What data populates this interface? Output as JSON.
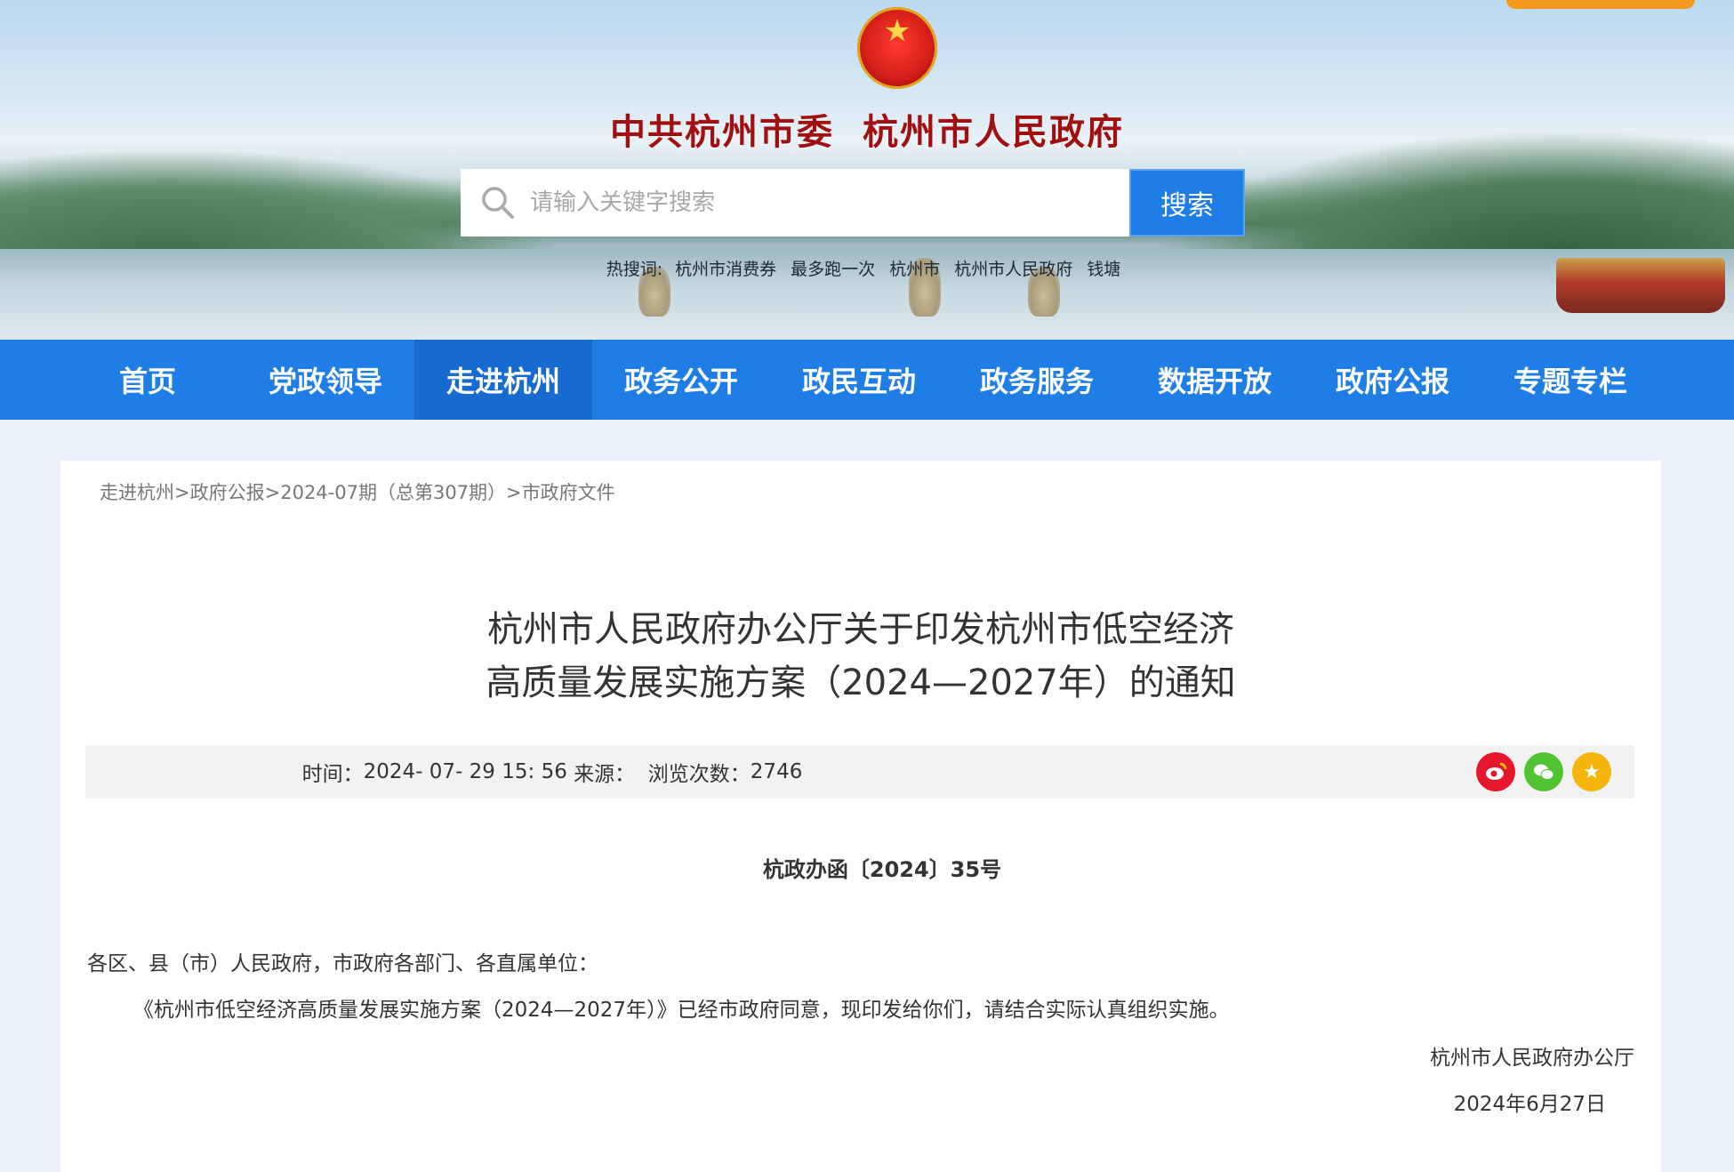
{
  "header": {
    "title_left": "中共杭州市委",
    "title_right": "杭州市人民政府",
    "emblem_icon": "national-emblem-icon",
    "search": {
      "placeholder": "请输入关键字搜索",
      "button_label": "搜索"
    },
    "hot_search": {
      "label": "热搜词:",
      "items": [
        "杭州市消费券",
        "最多跑一次",
        "杭州市",
        "杭州市人民政府",
        "钱塘"
      ]
    }
  },
  "nav": {
    "items": [
      {
        "label": "首页"
      },
      {
        "label": "党政领导"
      },
      {
        "label": "走进杭州"
      },
      {
        "label": "政务公开"
      },
      {
        "label": "政民互动"
      },
      {
        "label": "政务服务"
      },
      {
        "label": "数据开放"
      },
      {
        "label": "政府公报"
      },
      {
        "label": "专题专栏"
      }
    ],
    "active": "走进杭州",
    "colors": {
      "bar": "#1e7ee6",
      "active": "#176ad0"
    }
  },
  "breadcrumb": {
    "items": [
      "走进杭州",
      "政府公报",
      "2024-07期（总第307期）",
      "市政府文件"
    ],
    "separator": ">"
  },
  "article": {
    "title_line1": "杭州市人民政府办公厅关于印发杭州市低空经济",
    "title_line2": "高质量发展实施方案（2024—2027年）的通知",
    "meta": {
      "time_label": "时间：",
      "time_value": "2024- 07- 29 15: 56",
      "source_label": "来源：",
      "views_label": "浏览次数：",
      "views_value": "2746"
    },
    "share": [
      "weibo-icon",
      "wechat-icon",
      "favorite-icon"
    ],
    "doc_number": "杭政办函〔2024〕35号",
    "addressee": "各区、县（市）人民政府，市政府各部门、各直属单位：",
    "body": "《杭州市低空经济高质量发展实施方案（2024—2027年）》已经市政府同意，现印发给你们，请结合实际认真组织实施。",
    "signer": "杭州市人民政府办公厅",
    "date": "2024年6月27日"
  }
}
